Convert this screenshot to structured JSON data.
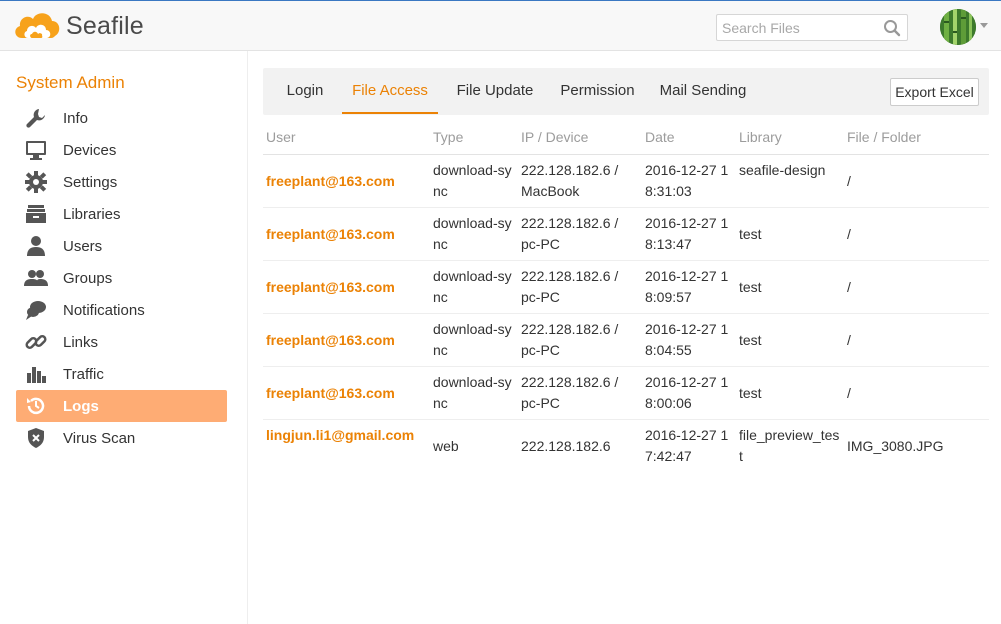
{
  "header": {
    "brand": "Seafile",
    "search_placeholder": "Search Files"
  },
  "sidebar": {
    "title": "System Admin",
    "items": [
      {
        "label": "Info",
        "icon": "wrench-icon"
      },
      {
        "label": "Devices",
        "icon": "monitor-icon"
      },
      {
        "label": "Settings",
        "icon": "gear-icon"
      },
      {
        "label": "Libraries",
        "icon": "archive-icon"
      },
      {
        "label": "Users",
        "icon": "user-icon"
      },
      {
        "label": "Groups",
        "icon": "group-icon"
      },
      {
        "label": "Notifications",
        "icon": "chat-bubble-icon"
      },
      {
        "label": "Links",
        "icon": "link-icon"
      },
      {
        "label": "Traffic",
        "icon": "bar-chart-icon"
      },
      {
        "label": "Logs",
        "icon": "history-icon",
        "active": true
      },
      {
        "label": "Virus Scan",
        "icon": "shield-x-icon"
      }
    ]
  },
  "tabs": [
    "Login",
    "File Access",
    "File Update",
    "Permission",
    "Mail Sending"
  ],
  "active_tab": "File Access",
  "export_label": "Export Excel",
  "table": {
    "headers": [
      "User",
      "Type",
      "IP / Device",
      "Date",
      "Library",
      "File / Folder"
    ],
    "rows": [
      {
        "user": "freeplant@163.com",
        "type": "download-sync",
        "ip": "222.128.182.6 / MacBook",
        "date": "2016-12-27 18:31:03",
        "library": "seafile-design",
        "file": "/"
      },
      {
        "user": "freeplant@163.com",
        "type": "download-sync",
        "ip": "222.128.182.6 / pc-PC",
        "date": "2016-12-27 18:13:47",
        "library": "test",
        "file": "/"
      },
      {
        "user": "freeplant@163.com",
        "type": "download-sync",
        "ip": "222.128.182.6 / pc-PC",
        "date": "2016-12-27 18:09:57",
        "library": "test",
        "file": "/"
      },
      {
        "user": "freeplant@163.com",
        "type": "download-sync",
        "ip": "222.128.182.6 / pc-PC",
        "date": "2016-12-27 18:04:55",
        "library": "test",
        "file": "/"
      },
      {
        "user": "freeplant@163.com",
        "type": "download-sync",
        "ip": "222.128.182.6 / pc-PC",
        "date": "2016-12-27 18:00:06",
        "library": "test",
        "file": "/"
      },
      {
        "user": "lingjun.li1@gmail.com",
        "type": "web",
        "ip": "222.128.182.6",
        "date": "2016-12-27 17:42:47",
        "library": "file_preview_test",
        "file": "IMG_3080.JPG"
      }
    ]
  },
  "colors": {
    "accent": "#eb8205",
    "active_bg": "#feac74"
  }
}
